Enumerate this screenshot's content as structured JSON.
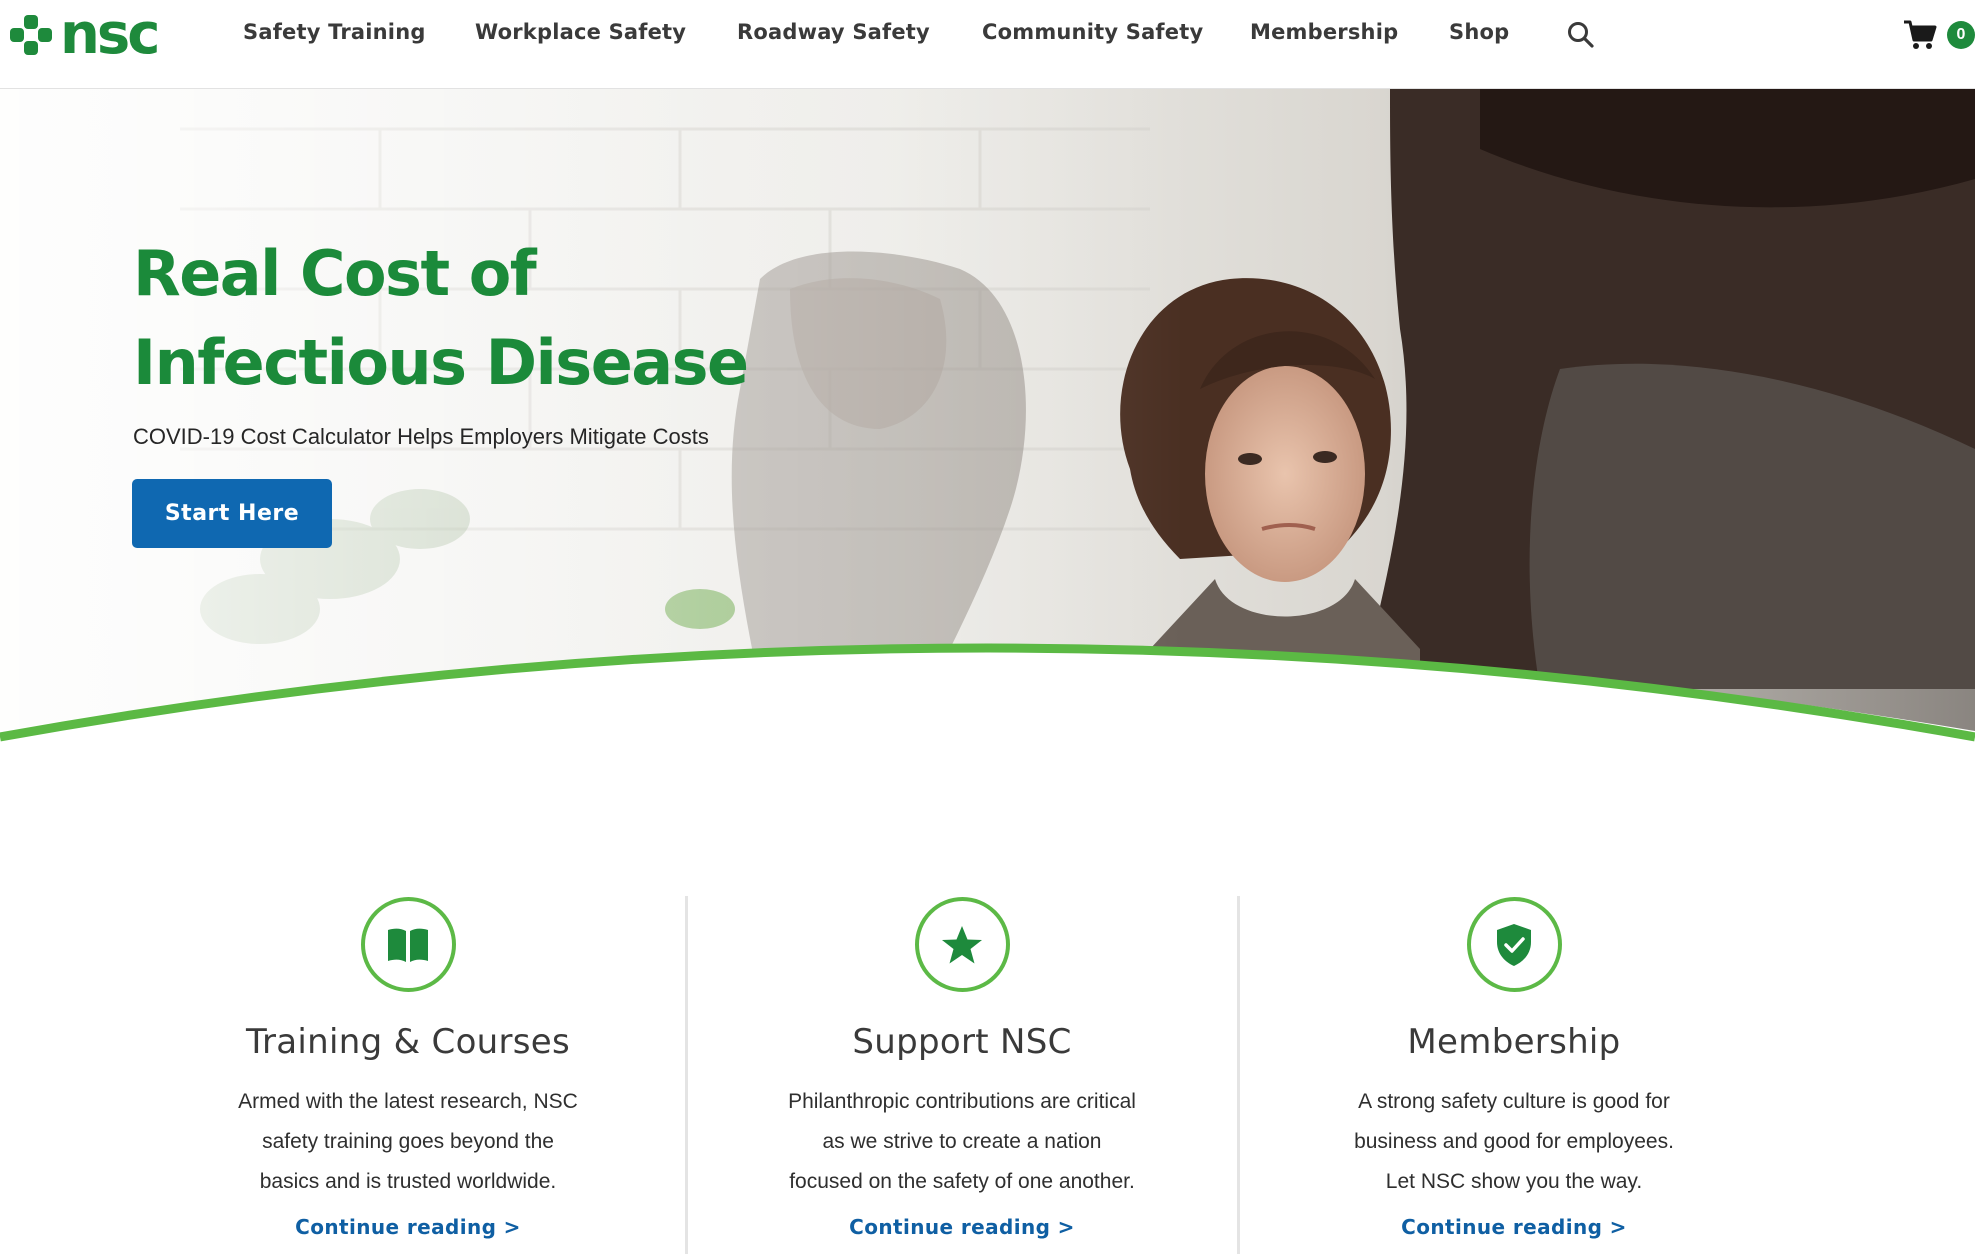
{
  "brand": {
    "logo_text": "nsc",
    "colors": {
      "green": "#1e8a3c",
      "blue": "#0f68b1",
      "accent_green": "#5cb946"
    }
  },
  "nav": {
    "items": [
      {
        "label": "Safety Training"
      },
      {
        "label": "Workplace Safety"
      },
      {
        "label": "Roadway Safety"
      },
      {
        "label": "Community Safety"
      },
      {
        "label": "Membership"
      },
      {
        "label": "Shop"
      }
    ],
    "search_icon": "search-icon",
    "cart_icon": "cart-icon",
    "cart_count": "0"
  },
  "hero": {
    "title_line1": "Real Cost of",
    "title_line2": "Infectious Disease",
    "subtitle": "COVID-19 Cost Calculator Helps Employers Mitigate Costs",
    "button_label": "Start Here"
  },
  "features": {
    "cards": [
      {
        "icon": "book-icon",
        "title": "Training & Courses",
        "text_lines": [
          "Armed with the latest research, NSC",
          "safety training goes beyond the",
          "basics and is trusted worldwide."
        ],
        "link": "Continue reading >"
      },
      {
        "icon": "star-icon",
        "title": "Support NSC",
        "text_lines": [
          "Philanthropic contributions are critical",
          "as we strive to create a nation",
          "focused on the safety of one another."
        ],
        "link": "Continue reading >"
      },
      {
        "icon": "shield-check-icon",
        "title": "Membership",
        "text_lines": [
          "A strong safety culture is good for",
          "business and good for employees.",
          "Let NSC show you the way."
        ],
        "link": "Continue reading >"
      }
    ]
  }
}
